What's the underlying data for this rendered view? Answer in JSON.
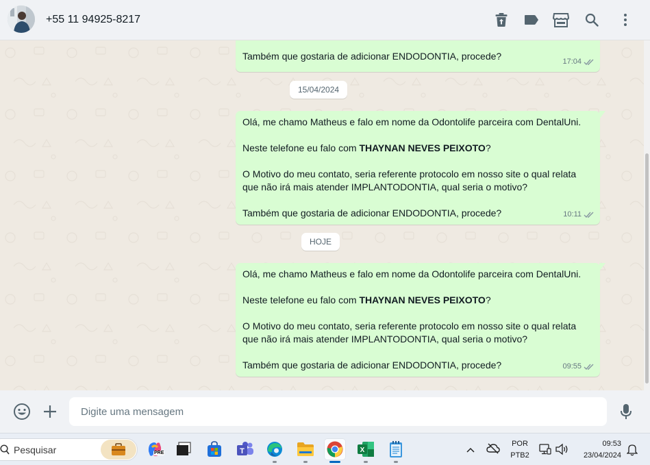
{
  "header": {
    "contact_name": "+55 11 94925-8217"
  },
  "messages": [
    {
      "lines": [
        "Também que gostaria de adicionar ENDODONTIA, procede?"
      ],
      "time": "17:04"
    },
    {
      "line1": "Olá, me chamo Matheus e falo em nome da Odontolife parceira com DentalUni.",
      "line2_prefix": "Neste telefone eu falo com ",
      "line2_bold": "THAYNAN NEVES PEIXOTO",
      "line2_suffix": "?",
      "line3": "O Motivo do meu contato, seria referente protocolo em nosso site o qual relata",
      "line4": "que não irá mais atender IMPLANTODONTIA, qual seria o motivo?",
      "line5": "Também que gostaria de adicionar ENDODONTIA, procede?",
      "time": "10:11"
    },
    {
      "line1": "Olá, me chamo Matheus e falo em nome da Odontolife parceira com DentalUni.",
      "line2_prefix": "Neste telefone eu falo com ",
      "line2_bold": "THAYNAN NEVES PEIXOTO",
      "line2_suffix": "?",
      "line3": "O Motivo do meu contato, seria referente protocolo em nosso site o qual relata",
      "line4": "que não irá mais atender IMPLANTODONTIA, qual seria o motivo?",
      "line5": "Também que gostaria de adicionar ENDODONTIA, procede?",
      "time": "09:55"
    }
  ],
  "date_separators": [
    "15/04/2024",
    "HOJE"
  ],
  "composer": {
    "placeholder": "Digite uma mensagem"
  },
  "taskbar": {
    "search_label": "Pesquisar",
    "copilot_badge": "PRE",
    "lang_top": "POR",
    "lang_bottom": "PTB2",
    "clock_time": "09:53",
    "clock_date": "23/04/2024"
  },
  "icons": {
    "header": [
      "trash-icon",
      "label-icon",
      "store-icon",
      "search-icon",
      "more-vertical-icon"
    ],
    "composer": [
      "emoji-icon",
      "plus-icon",
      "microphone-icon"
    ]
  },
  "colors": {
    "outgoing_bubble": "#d9fdd3",
    "chat_background": "#efeae2",
    "header_background": "#f0f2f5",
    "read_ticks": "#8696a0"
  }
}
